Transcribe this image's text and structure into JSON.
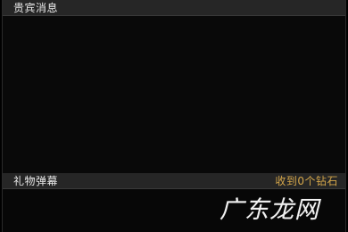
{
  "vip_panel": {
    "title": "贵宾消息"
  },
  "gift_panel": {
    "title": "礼物弹幕",
    "received_text": "收到0个钻石"
  },
  "colors": {
    "background": "#000000",
    "header_bg": "#262626",
    "title_text": "#e8e8e8",
    "accent_gold": "#d4a64a"
  },
  "watermark": {
    "text": "广东龙网"
  }
}
